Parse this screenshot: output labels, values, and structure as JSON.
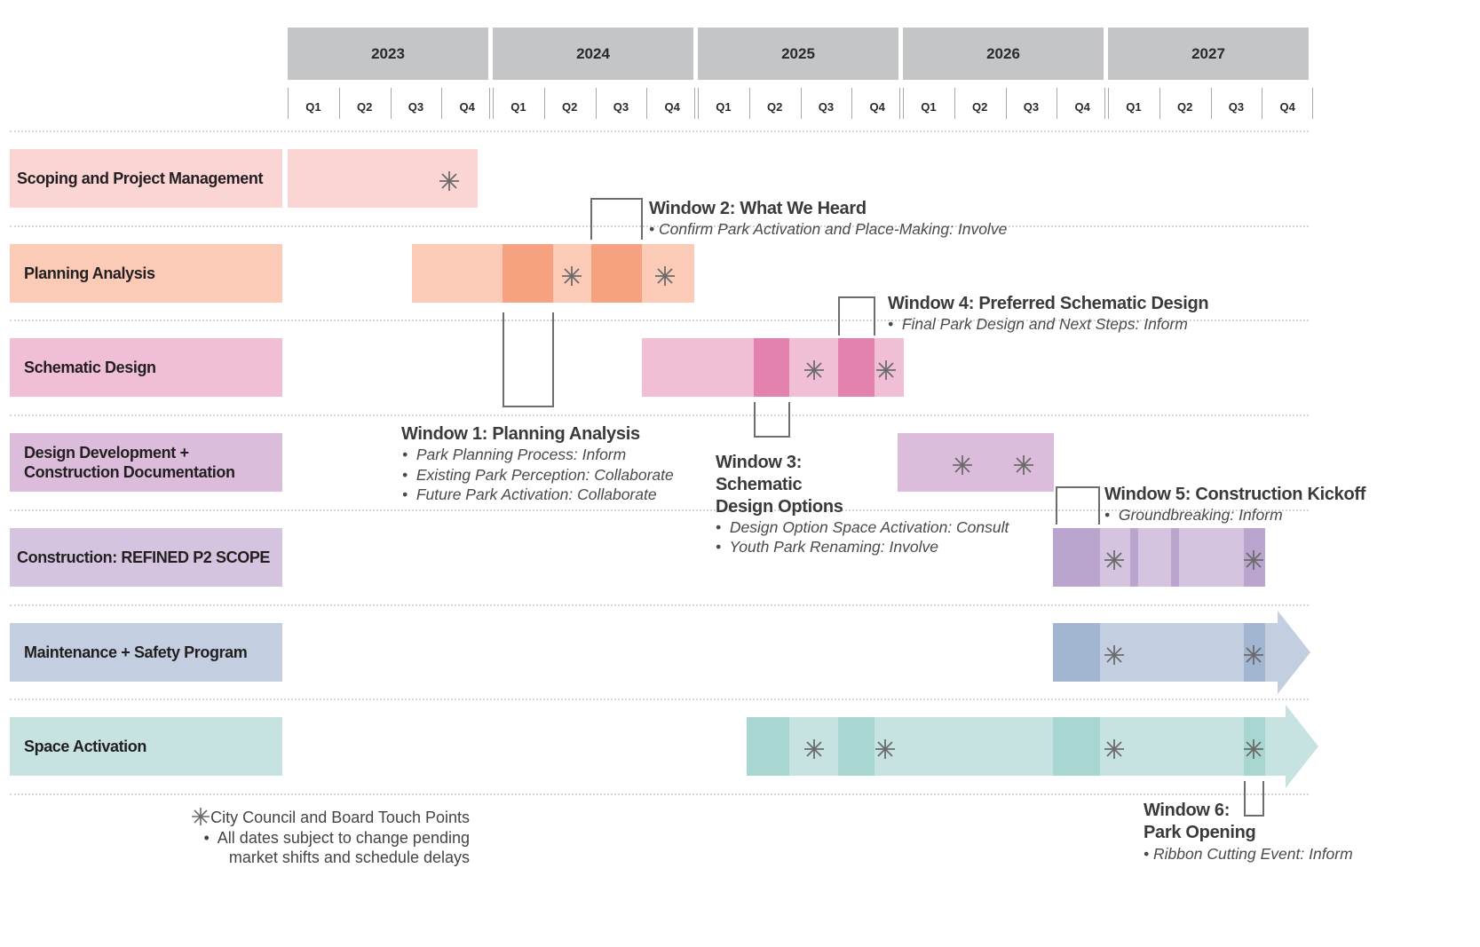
{
  "chart_data": {
    "type": "gantt",
    "title": "",
    "years": [
      "2023",
      "2024",
      "2025",
      "2026",
      "2027"
    ],
    "quarters": [
      "Q1",
      "Q2",
      "Q3",
      "Q4"
    ],
    "time_unit": "quarters from start of 2023 Q1",
    "rows": [
      {
        "label": "Scoping and Project Management",
        "color": "#fbd5d3",
        "accent": "#fbd5d3",
        "segments": [
          {
            "start": 0,
            "end": 3.7,
            "tone": "light"
          }
        ],
        "touch_points": [
          3.15
        ],
        "arrow": false
      },
      {
        "label": "Planning Analysis",
        "color": "#fccbb8",
        "accent": "#f6a17f",
        "segments": [
          {
            "start": 2.42,
            "end": 7.93,
            "tone": "light"
          },
          {
            "start": 4.19,
            "end": 5.18,
            "tone": "dark"
          },
          {
            "start": 5.92,
            "end": 6.91,
            "tone": "dark"
          }
        ],
        "touch_points": [
          5.54,
          7.36
        ],
        "arrow": false
      },
      {
        "label": "Schematic Design",
        "color": "#f1bfd5",
        "accent": "#e482ae",
        "segments": [
          {
            "start": 6.91,
            "end": 12.02,
            "tone": "light"
          },
          {
            "start": 9.09,
            "end": 9.78,
            "tone": "dark"
          },
          {
            "start": 10.74,
            "end": 11.45,
            "tone": "dark"
          }
        ],
        "touch_points": [
          10.27,
          11.67
        ],
        "arrow": false
      },
      {
        "label": "Design Development + Construction Documentation",
        "label_lines": [
          "Design Development +",
          "Construction Documentation"
        ],
        "color": "#dbbcdb",
        "accent": "#dbbcdb",
        "segments": [
          {
            "start": 11.9,
            "end": 14.94,
            "tone": "light"
          }
        ],
        "touch_points": [
          13.16,
          14.35
        ],
        "arrow": false
      },
      {
        "label": "Construction: REFINED P2 SCOPE",
        "color": "#d4c4df",
        "accent": "#b9a5cd",
        "segments": [
          {
            "start": 14.93,
            "end": 19.06,
            "tone": "light"
          },
          {
            "start": 14.93,
            "end": 15.84,
            "tone": "dark"
          },
          {
            "start": 16.43,
            "end": 16.59,
            "tone": "dark"
          },
          {
            "start": 17.23,
            "end": 17.38,
            "tone": "dark"
          },
          {
            "start": 18.65,
            "end": 19.06,
            "tone": "dark"
          }
        ],
        "touch_points": [
          16.12,
          18.84
        ],
        "arrow": false
      },
      {
        "label": "Maintenance + Safety Program",
        "color": "#c3cfe0",
        "accent": "#a2b6d1",
        "segments": [
          {
            "start": 14.93,
            "end": 19.3,
            "tone": "light"
          },
          {
            "start": 14.93,
            "end": 15.84,
            "tone": "dark"
          },
          {
            "start": 18.65,
            "end": 19.06,
            "tone": "dark"
          }
        ],
        "touch_points": [
          16.12,
          18.84
        ],
        "arrow": true
      },
      {
        "label": "Space Activation",
        "color": "#c6e3e1",
        "accent": "#a8d6d1",
        "segments": [
          {
            "start": 8.95,
            "end": 19.47,
            "tone": "light"
          },
          {
            "start": 8.95,
            "end": 9.78,
            "tone": "dark"
          },
          {
            "start": 10.74,
            "end": 11.45,
            "tone": "dark"
          },
          {
            "start": 14.93,
            "end": 15.84,
            "tone": "dark"
          },
          {
            "start": 18.65,
            "end": 19.06,
            "tone": "dark"
          }
        ],
        "touch_points": [
          10.27,
          11.65,
          16.12,
          18.84
        ],
        "arrow": true
      }
    ],
    "windows": [
      {
        "title": "Window 1: Planning Analysis",
        "items": [
          "Park Planning Process: Inform",
          "Existing Park Perception: Collaborate",
          "Future Park Activation: Collaborate"
        ]
      },
      {
        "title": "Window 2: What We Heard",
        "items": [
          "Confirm Park Activation and Place-Making: Involve"
        ]
      },
      {
        "title_lines": [
          "Window 3:",
          "Schematic",
          "Design Options"
        ],
        "title": "Window 3: Schematic Design Options",
        "items": [
          "Design Option Space Activation: Consult",
          "Youth Park Renaming: Involve"
        ]
      },
      {
        "title": "Window 4: Preferred Schematic Design",
        "items": [
          "Final Park Design and Next Steps: Inform"
        ]
      },
      {
        "title": "Window 5: Construction Kickoff",
        "items": [
          "Groundbreaking: Inform"
        ]
      },
      {
        "title_lines": [
          "Window 6:",
          "Park Opening"
        ],
        "title": "Window 6: Park Opening",
        "items": [
          "Ribbon Cutting Event: Inform"
        ]
      }
    ],
    "legend": {
      "touch_point_label": "City Council and Board Touch Points",
      "note_lines": [
        "All dates subject to change pending",
        "market shifts and schedule delays"
      ]
    },
    "colors": {
      "header_bg": "#c4c5c7",
      "star": "#6b6b6b",
      "bracket": "#6d6d6d"
    }
  }
}
